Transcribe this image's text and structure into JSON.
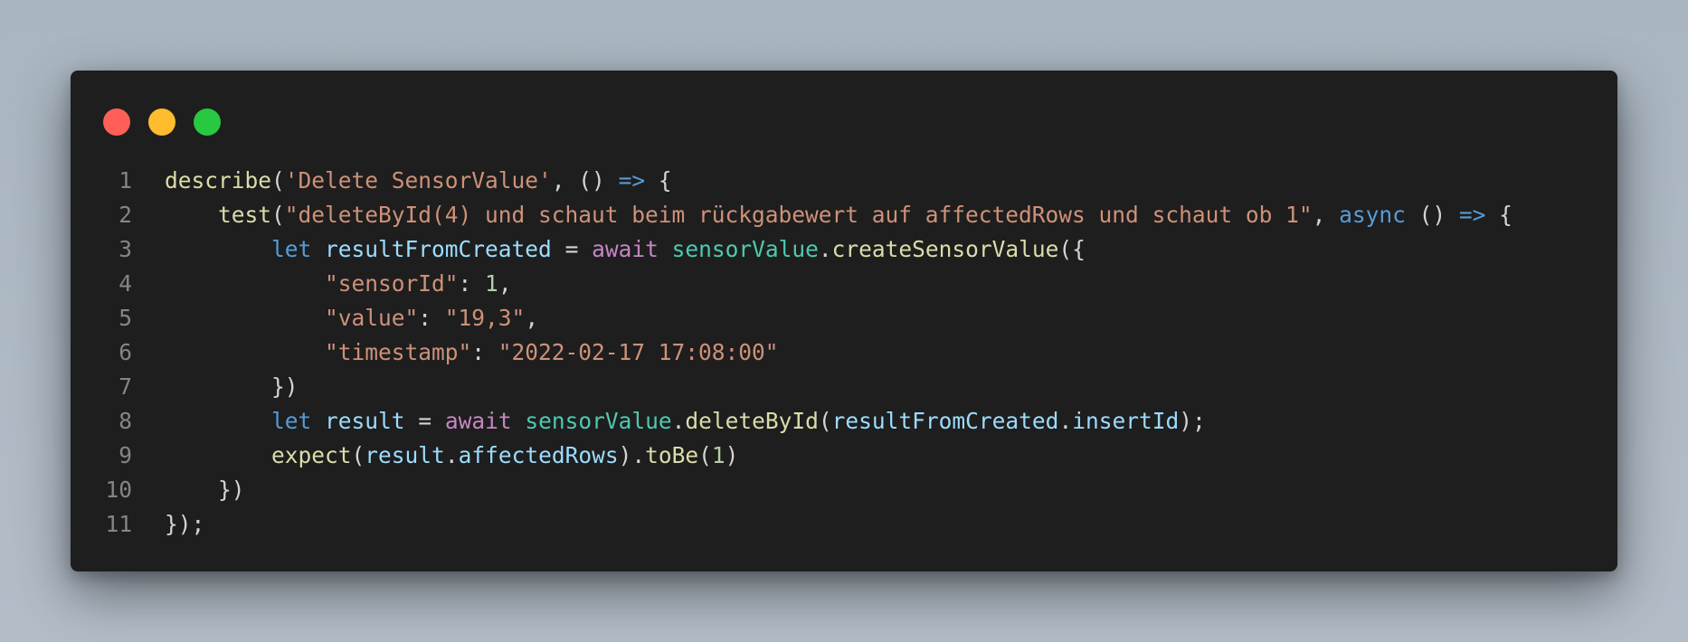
{
  "window": {
    "controls": [
      {
        "name": "close",
        "color": "#ff5f57"
      },
      {
        "name": "minimize",
        "color": "#febc2e"
      },
      {
        "name": "maximize",
        "color": "#28c840"
      }
    ]
  },
  "token_colors": {
    "fn": "#dcdcaa",
    "str": "#ce9178",
    "kw": "#569cd6",
    "ctrl": "#c586c0",
    "var": "#9cdcfe",
    "cls": "#4ec9b0",
    "num": "#b5cea8",
    "pun": "#d4d4d4"
  },
  "code": {
    "lines": [
      {
        "num": "1",
        "tokens": [
          {
            "t": "describe",
            "c": "fn"
          },
          {
            "t": "(",
            "c": "pun"
          },
          {
            "t": "'Delete SensorValue'",
            "c": "str"
          },
          {
            "t": ", () ",
            "c": "pun"
          },
          {
            "t": "=>",
            "c": "kw"
          },
          {
            "t": " {",
            "c": "pun"
          }
        ]
      },
      {
        "num": "2",
        "tokens": [
          {
            "t": "    ",
            "c": "pun"
          },
          {
            "t": "test",
            "c": "fn"
          },
          {
            "t": "(",
            "c": "pun"
          },
          {
            "t": "\"deleteById(4) und schaut beim rückgabewert auf affectedRows und schaut ob 1\"",
            "c": "str"
          },
          {
            "t": ", ",
            "c": "pun"
          },
          {
            "t": "async",
            "c": "kw"
          },
          {
            "t": " () ",
            "c": "pun"
          },
          {
            "t": "=>",
            "c": "kw"
          },
          {
            "t": " {",
            "c": "pun"
          }
        ]
      },
      {
        "num": "3",
        "tokens": [
          {
            "t": "        ",
            "c": "pun"
          },
          {
            "t": "let",
            "c": "kw"
          },
          {
            "t": " ",
            "c": "pun"
          },
          {
            "t": "resultFromCreated",
            "c": "var"
          },
          {
            "t": " = ",
            "c": "pun"
          },
          {
            "t": "await",
            "c": "ctrl"
          },
          {
            "t": " ",
            "c": "pun"
          },
          {
            "t": "sensorValue",
            "c": "cls"
          },
          {
            "t": ".",
            "c": "pun"
          },
          {
            "t": "createSensorValue",
            "c": "fn"
          },
          {
            "t": "({",
            "c": "pun"
          }
        ]
      },
      {
        "num": "4",
        "tokens": [
          {
            "t": "            ",
            "c": "pun"
          },
          {
            "t": "\"sensorId\"",
            "c": "str"
          },
          {
            "t": ": ",
            "c": "pun"
          },
          {
            "t": "1",
            "c": "num"
          },
          {
            "t": ",",
            "c": "pun"
          }
        ]
      },
      {
        "num": "5",
        "tokens": [
          {
            "t": "            ",
            "c": "pun"
          },
          {
            "t": "\"value\"",
            "c": "str"
          },
          {
            "t": ": ",
            "c": "pun"
          },
          {
            "t": "\"19,3\"",
            "c": "str"
          },
          {
            "t": ",",
            "c": "pun"
          }
        ]
      },
      {
        "num": "6",
        "tokens": [
          {
            "t": "            ",
            "c": "pun"
          },
          {
            "t": "\"timestamp\"",
            "c": "str"
          },
          {
            "t": ": ",
            "c": "pun"
          },
          {
            "t": "\"2022-02-17 17:08:00\"",
            "c": "str"
          }
        ]
      },
      {
        "num": "7",
        "tokens": [
          {
            "t": "        })",
            "c": "pun"
          }
        ]
      },
      {
        "num": "8",
        "tokens": [
          {
            "t": "        ",
            "c": "pun"
          },
          {
            "t": "let",
            "c": "kw"
          },
          {
            "t": " ",
            "c": "pun"
          },
          {
            "t": "result",
            "c": "var"
          },
          {
            "t": " = ",
            "c": "pun"
          },
          {
            "t": "await",
            "c": "ctrl"
          },
          {
            "t": " ",
            "c": "pun"
          },
          {
            "t": "sensorValue",
            "c": "cls"
          },
          {
            "t": ".",
            "c": "pun"
          },
          {
            "t": "deleteById",
            "c": "fn"
          },
          {
            "t": "(",
            "c": "pun"
          },
          {
            "t": "resultFromCreated",
            "c": "var"
          },
          {
            "t": ".",
            "c": "pun"
          },
          {
            "t": "insertId",
            "c": "var"
          },
          {
            "t": ");",
            "c": "pun"
          }
        ]
      },
      {
        "num": "9",
        "tokens": [
          {
            "t": "        ",
            "c": "pun"
          },
          {
            "t": "expect",
            "c": "fn"
          },
          {
            "t": "(",
            "c": "pun"
          },
          {
            "t": "result",
            "c": "var"
          },
          {
            "t": ".",
            "c": "pun"
          },
          {
            "t": "affectedRows",
            "c": "var"
          },
          {
            "t": ").",
            "c": "pun"
          },
          {
            "t": "toBe",
            "c": "fn"
          },
          {
            "t": "(",
            "c": "pun"
          },
          {
            "t": "1",
            "c": "num"
          },
          {
            "t": ")",
            "c": "pun"
          }
        ]
      },
      {
        "num": "10",
        "tokens": [
          {
            "t": "    })",
            "c": "pun"
          }
        ]
      },
      {
        "num": "11",
        "tokens": [
          {
            "t": "});",
            "c": "pun"
          }
        ]
      }
    ]
  }
}
